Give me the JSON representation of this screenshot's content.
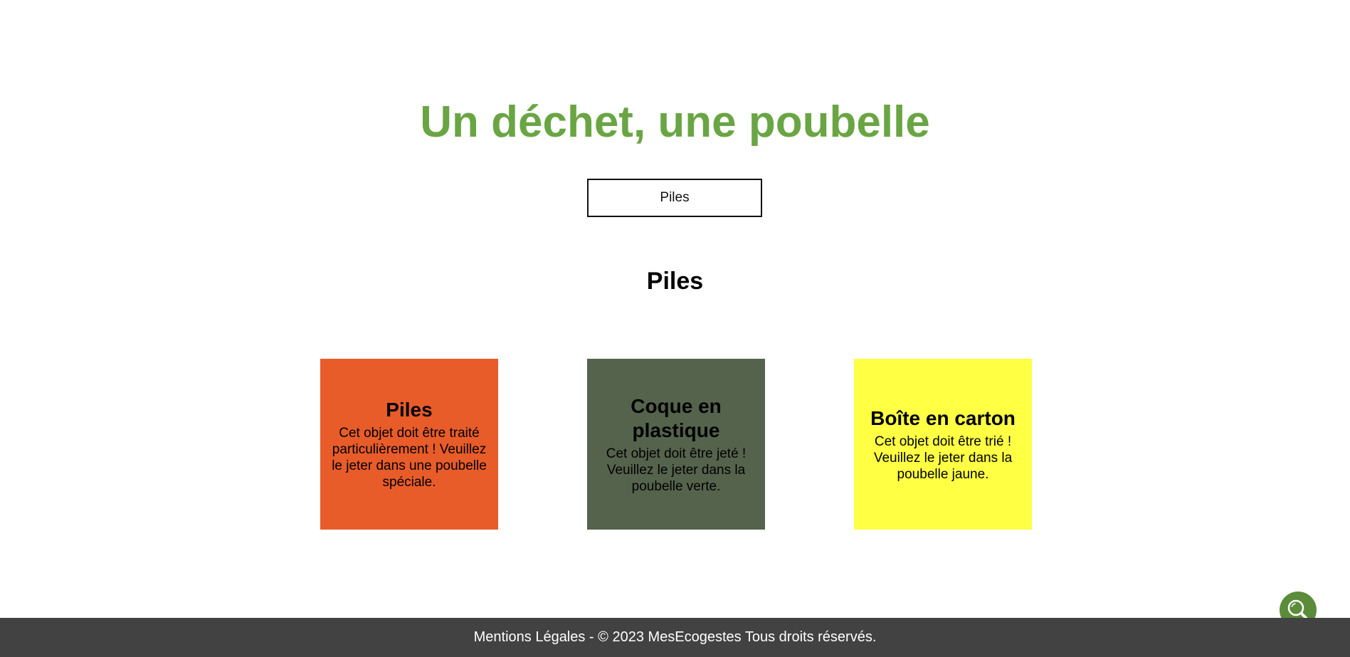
{
  "header": {
    "title": "Un déchet, une poubelle"
  },
  "search": {
    "value": "Piles"
  },
  "result": {
    "heading": "Piles"
  },
  "cards": [
    {
      "title": "Piles",
      "text": "Cet objet doit être traité particulièrement ! Veuillez le jeter dans une poubelle spéciale.",
      "color": "#e85c2a"
    },
    {
      "title": "Coque en plastique",
      "text": "Cet objet doit être jeté ! Veuillez le jeter dans la poubelle verte.",
      "color": "#55634c"
    },
    {
      "title": "Boîte en carton",
      "text": "Cet objet doit être trié ! Veuillez le jeter dans la poubelle jaune.",
      "color": "#ffff44"
    }
  ],
  "floating_button": {
    "icon": "magnifier-icon",
    "color": "#5b8c3a"
  },
  "footer": {
    "text": "Mentions Légales - © 2023 MesEcogestes Tous droits réservés.",
    "background": "#424242"
  },
  "colors": {
    "accent": "#6aa544"
  }
}
